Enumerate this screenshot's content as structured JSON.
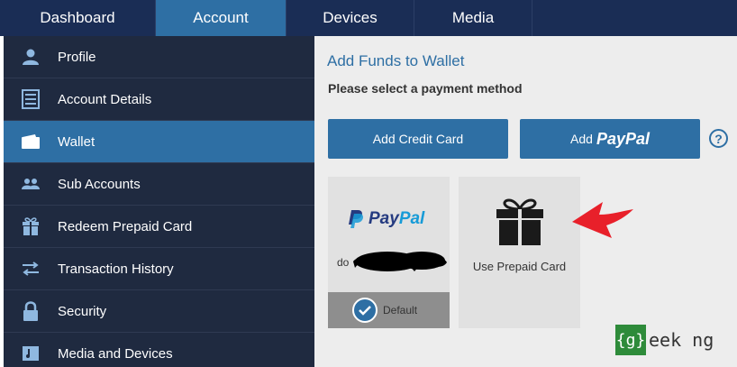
{
  "topnav": {
    "tabs": [
      {
        "label": "Dashboard"
      },
      {
        "label": "Account"
      },
      {
        "label": "Devices"
      },
      {
        "label": "Media"
      }
    ],
    "active": "Account"
  },
  "sidebar": {
    "items": [
      {
        "label": "Profile",
        "icon": "user-icon"
      },
      {
        "label": "Account Details",
        "icon": "document-icon"
      },
      {
        "label": "Wallet",
        "icon": "wallet-icon"
      },
      {
        "label": "Sub Accounts",
        "icon": "users-icon"
      },
      {
        "label": "Redeem Prepaid Card",
        "icon": "gift-icon"
      },
      {
        "label": "Transaction History",
        "icon": "swap-arrows-icon"
      },
      {
        "label": "Security",
        "icon": "lock-icon"
      },
      {
        "label": "Media and Devices",
        "icon": "media-icon"
      }
    ],
    "active": "Wallet"
  },
  "content": {
    "title": "Add Funds to Wallet",
    "subtitle": "Please select a payment method",
    "buttons": {
      "credit": "Add Credit Card",
      "paypal_prefix": "Add",
      "paypal_word": "PayPal"
    },
    "help": "?",
    "cards": {
      "paypal": {
        "logo_dark": "Pay",
        "logo_light": "Pal",
        "email_visible": "do",
        "default_label": "Default"
      },
      "prepaid": {
        "label": "Use Prepaid Card"
      }
    }
  },
  "watermark": {
    "bracket_text": "{g}",
    "rest_text": "eek ng"
  },
  "colors": {
    "nav_bg": "#1a2d55",
    "accent": "#2e6fa4",
    "sidebar_bg": "#1f2a40",
    "content_bg": "#ededed",
    "arrow": "#e8202a"
  }
}
